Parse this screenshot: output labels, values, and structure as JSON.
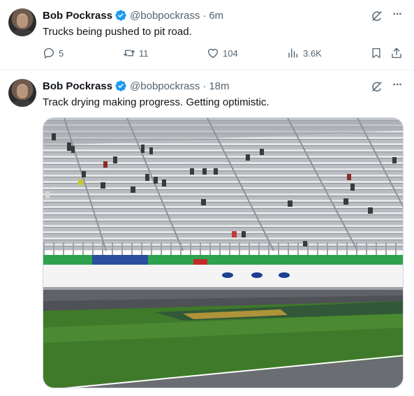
{
  "tweets": [
    {
      "author_name": "Bob Pockrass",
      "handle": "@bobpockrass",
      "time": "6m",
      "text": "Trucks being pushed to pit road.",
      "replies": "5",
      "reposts": "11",
      "likes": "104",
      "views": "3.6K"
    },
    {
      "author_name": "Bob Pockrass",
      "handle": "@bobpockrass",
      "time": "18m",
      "text": "Track drying making progress. Getting optimistic.",
      "media": {
        "type": "photo",
        "wall_sponsor_logos": [
          "Ford",
          "Ford",
          "Ford"
        ]
      }
    }
  ],
  "separator": "·",
  "icons": {
    "verified": "verified-badge-icon",
    "grok": "grok-icon",
    "more": "more-icon",
    "reply": "reply-icon",
    "repost": "repost-icon",
    "like": "like-icon",
    "views": "views-icon",
    "bookmark": "bookmark-icon",
    "share": "share-icon"
  },
  "colors": {
    "verified_blue": "#1d9bf0",
    "secondary_text": "#536471",
    "primary_text": "#0f1419"
  }
}
